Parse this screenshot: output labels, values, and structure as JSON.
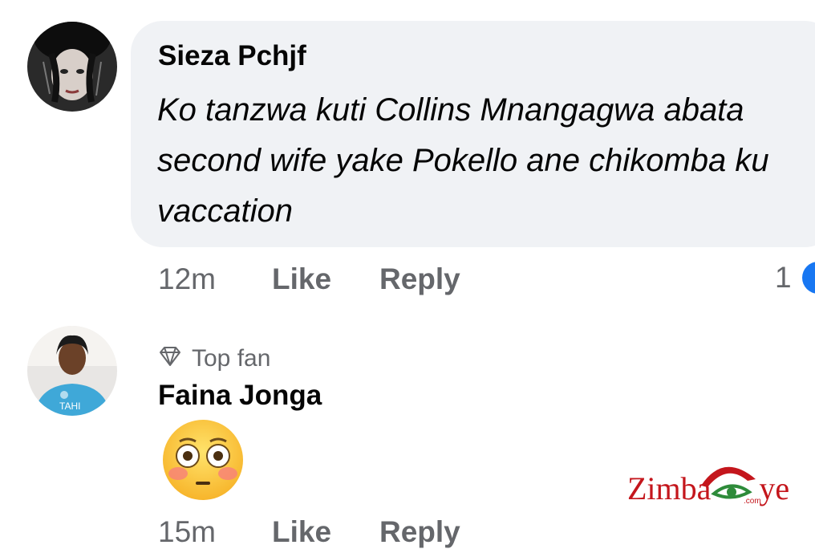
{
  "comments": [
    {
      "author": "Sieza Pchjf",
      "text": "Ko tanzwa kuti Collins Mnangagwa abata second wife yake Pokello ane chikomba ku vaccation",
      "time": "12m",
      "like_label": "Like",
      "reply_label": "Reply",
      "reaction_count": "1",
      "reaction_icon": "like-icon"
    },
    {
      "badge": "Top fan",
      "badge_icon": "diamond-icon",
      "author": "Faina Jonga",
      "content": "flushed-face-emoji",
      "time": "15m",
      "like_label": "Like",
      "reply_label": "Reply"
    }
  ],
  "watermark": {
    "text_left": "Zimba",
    "text_right": "ye",
    "suffix": ".com"
  },
  "colors": {
    "bubble_bg": "#f0f2f5",
    "meta_text": "#65676b",
    "reaction_blue": "#1877f2",
    "watermark_red": "#c4161c",
    "watermark_green": "#2e8b3a"
  }
}
